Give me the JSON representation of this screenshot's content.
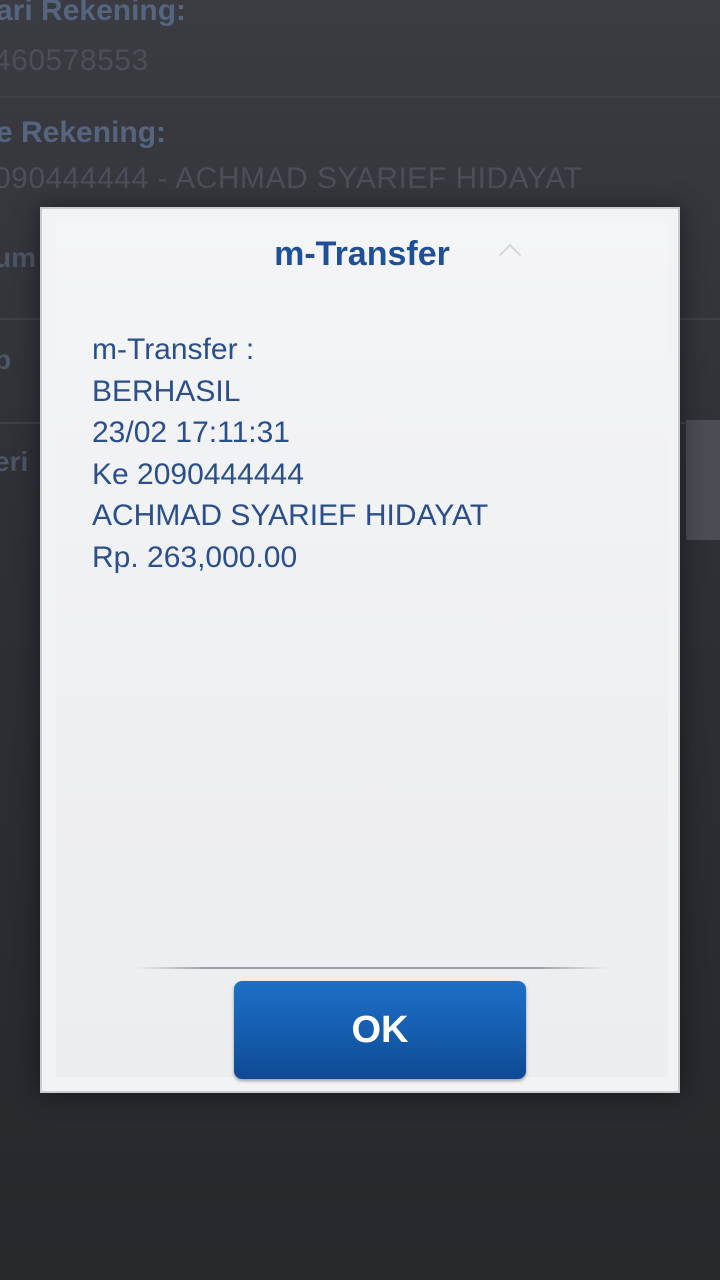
{
  "background_form": {
    "field1_label": "ari Rekening:",
    "field1_value": "460578553",
    "field2_label": "e Rekening:",
    "field2_value": "090444444 - ACHMAD SYARIEF HIDAYAT",
    "side_label_1": "um",
    "side_label_2": "p",
    "side_label_3": "eri"
  },
  "dialog": {
    "title": "m-Transfer",
    "message_lines": [
      "m-Transfer :",
      "BERHASIL",
      "23/02 17:11:31",
      "Ke 2090444444",
      "ACHMAD SYARIEF HIDAYAT",
      "Rp. 263,000.00"
    ],
    "ok_label": "OK"
  },
  "colors": {
    "title": "#1f4f96",
    "message_text": "#2a4f8a",
    "button": "#1660b3"
  }
}
